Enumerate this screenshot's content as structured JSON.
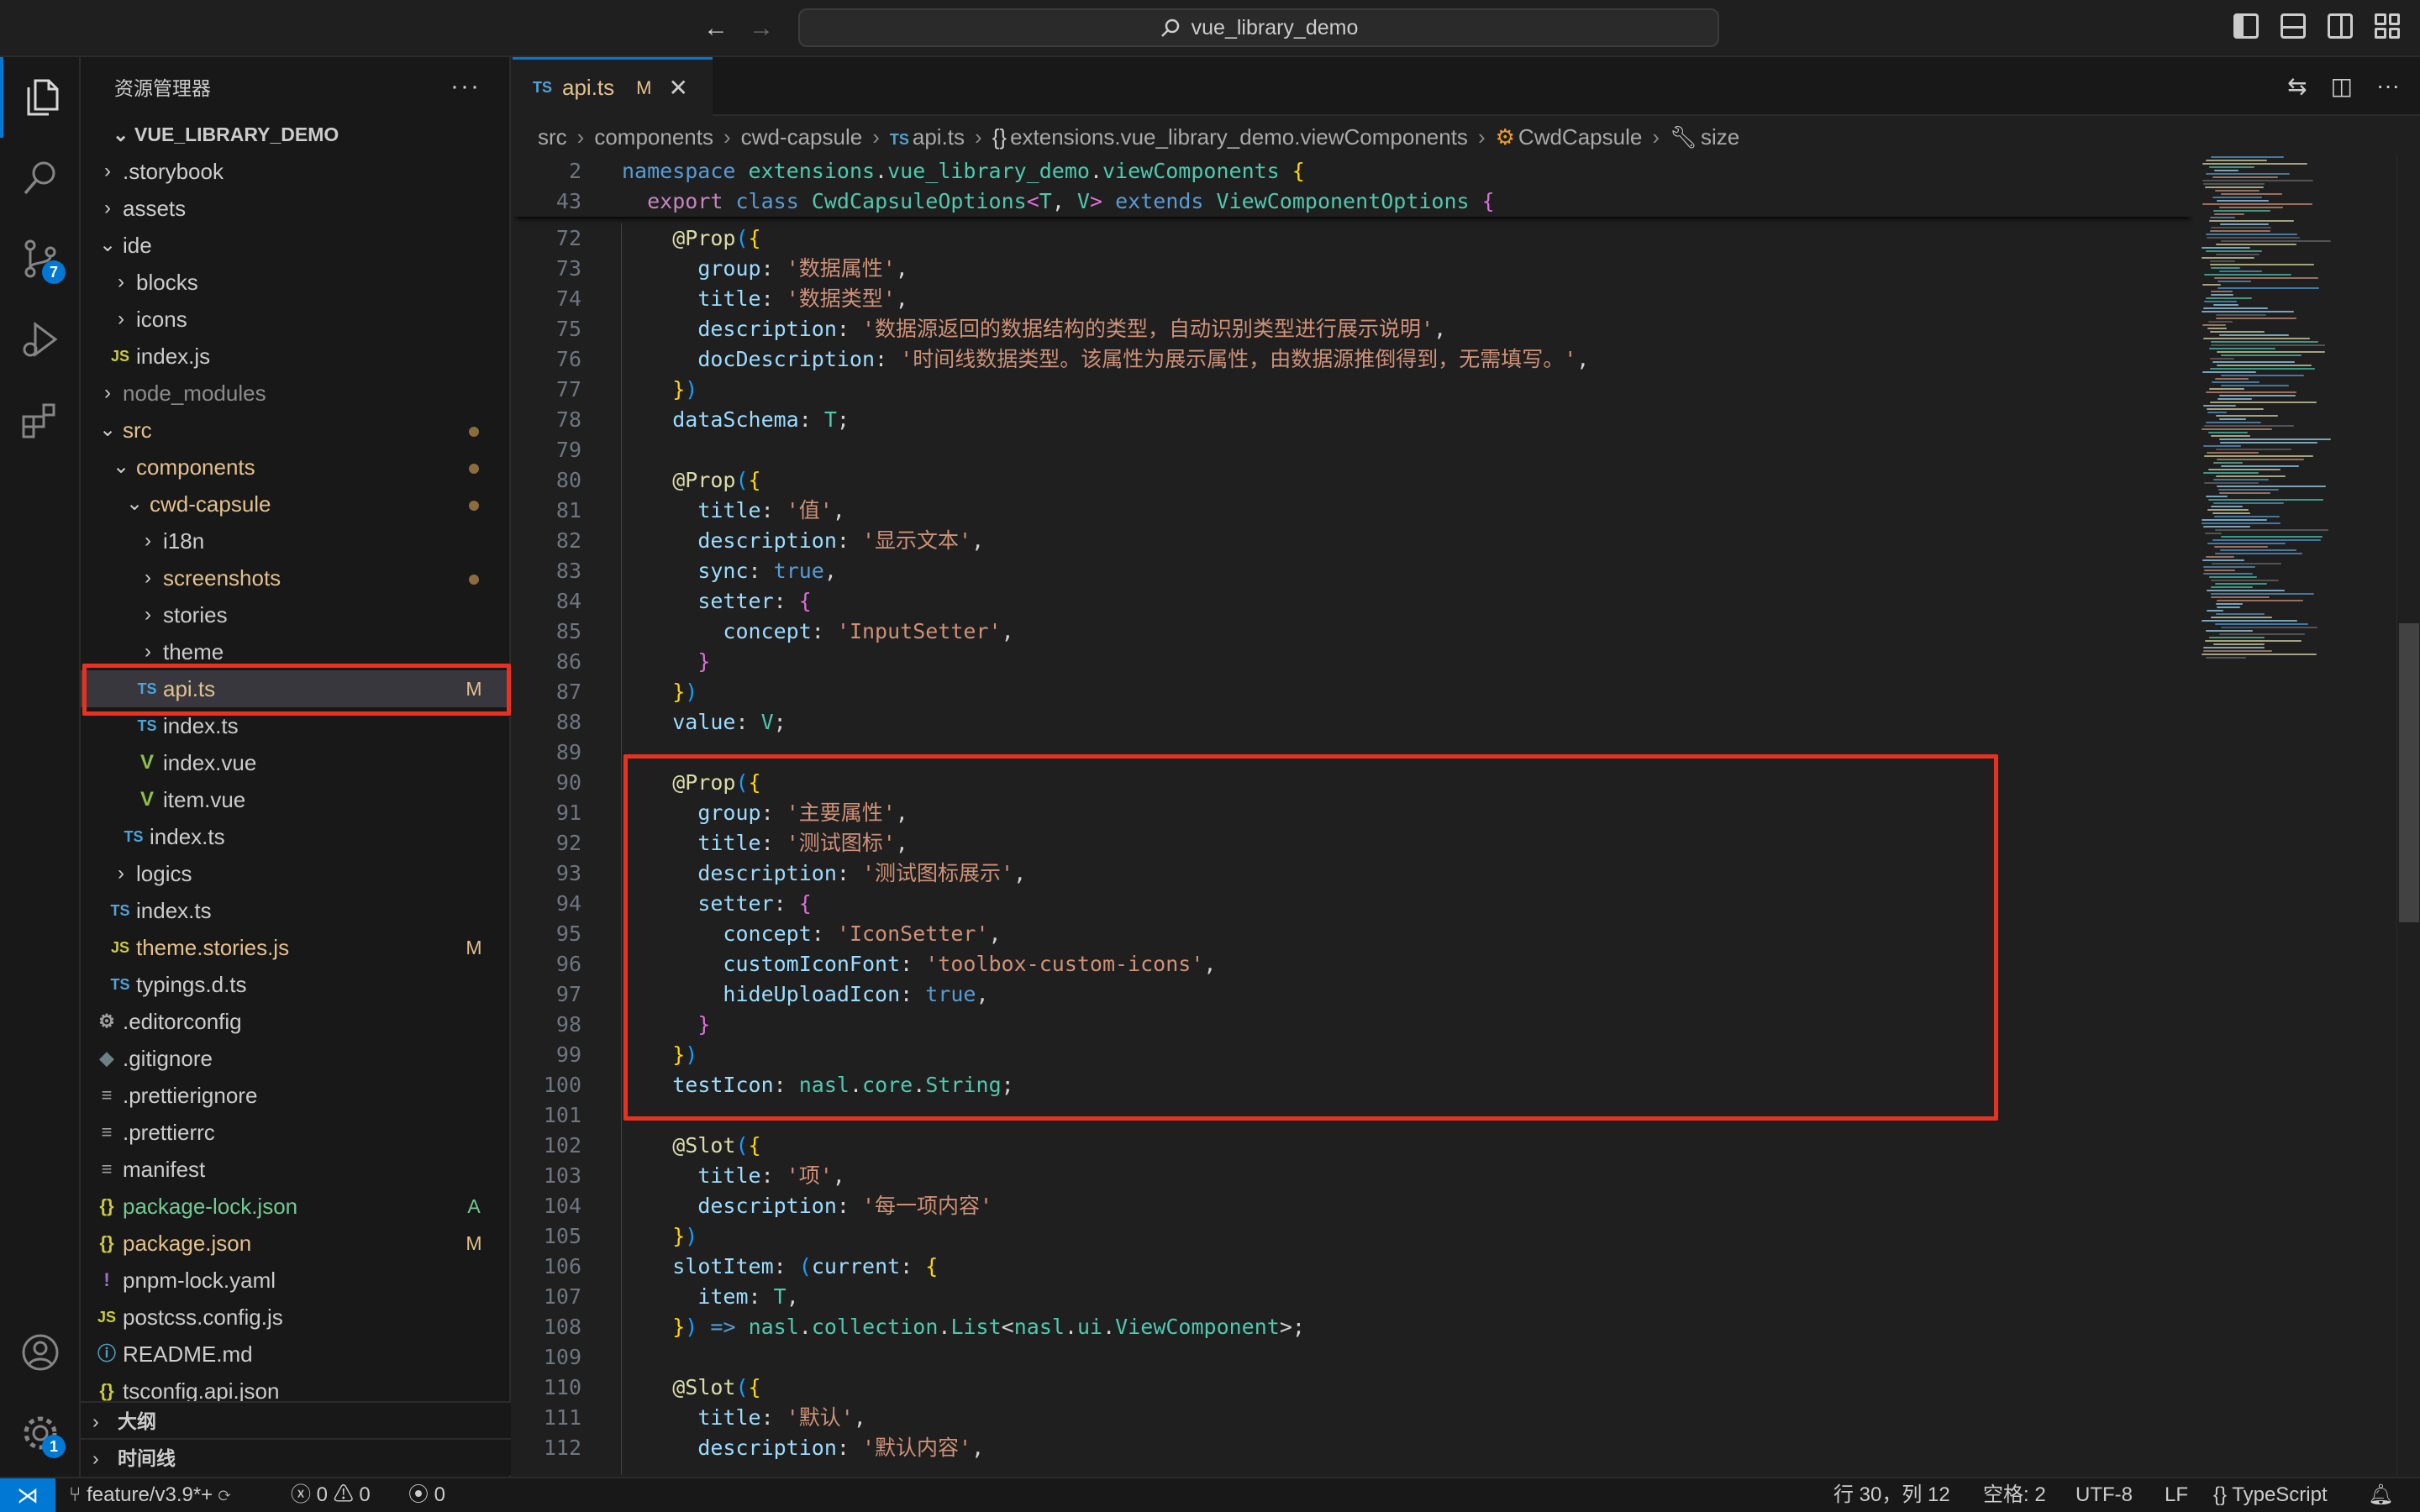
{
  "titlebar": {
    "back_icon": "arrow-left-icon",
    "forward_icon": "arrow-right-icon",
    "search_text": "vue_library_demo"
  },
  "activity": {
    "scm_badge": "7",
    "settings_badge": "1"
  },
  "sidebar": {
    "title": "资源管理器",
    "root": "VUE_LIBRARY_DEMO",
    "items": [
      {
        "label": ".storybook",
        "depth": 1,
        "kind": "folder",
        "open": false
      },
      {
        "label": "assets",
        "depth": 1,
        "kind": "folder",
        "open": false
      },
      {
        "label": "ide",
        "depth": 1,
        "kind": "folder",
        "open": true
      },
      {
        "label": "blocks",
        "depth": 2,
        "kind": "folder",
        "open": false
      },
      {
        "label": "icons",
        "depth": 2,
        "kind": "folder",
        "open": false
      },
      {
        "label": "index.js",
        "depth": 2,
        "kind": "js"
      },
      {
        "label": "node_modules",
        "depth": 1,
        "kind": "folder",
        "open": false,
        "dim": true
      },
      {
        "label": "src",
        "depth": 1,
        "kind": "folder",
        "open": true,
        "dot": true,
        "color": "#e2c08d"
      },
      {
        "label": "components",
        "depth": 2,
        "kind": "folder",
        "open": true,
        "dot": true,
        "color": "#e2c08d"
      },
      {
        "label": "cwd-capsule",
        "depth": 3,
        "kind": "folder",
        "open": true,
        "dot": true,
        "color": "#e2c08d"
      },
      {
        "label": "i18n",
        "depth": 4,
        "kind": "folder",
        "open": false
      },
      {
        "label": "screenshots",
        "depth": 4,
        "kind": "folder",
        "open": false,
        "dot": true,
        "color": "#e2c08d"
      },
      {
        "label": "stories",
        "depth": 4,
        "kind": "folder",
        "open": false
      },
      {
        "label": "theme",
        "depth": 4,
        "kind": "folder",
        "open": false
      },
      {
        "label": "api.ts",
        "depth": 4,
        "kind": "ts",
        "status": "M",
        "color": "#e2c08d",
        "selected": true
      },
      {
        "label": "index.ts",
        "depth": 4,
        "kind": "ts"
      },
      {
        "label": "index.vue",
        "depth": 4,
        "kind": "vue"
      },
      {
        "label": "item.vue",
        "depth": 4,
        "kind": "vue"
      },
      {
        "label": "index.ts",
        "depth": 3,
        "kind": "ts"
      },
      {
        "label": "logics",
        "depth": 2,
        "kind": "folder",
        "open": false
      },
      {
        "label": "index.ts",
        "depth": 2,
        "kind": "ts"
      },
      {
        "label": "theme.stories.js",
        "depth": 2,
        "kind": "js",
        "status": "M",
        "color": "#e2c08d"
      },
      {
        "label": "typings.d.ts",
        "depth": 2,
        "kind": "ts"
      },
      {
        "label": ".editorconfig",
        "depth": 1,
        "kind": "gear"
      },
      {
        "label": ".gitignore",
        "depth": 1,
        "kind": "git"
      },
      {
        "label": ".prettierignore",
        "depth": 1,
        "kind": "lines"
      },
      {
        "label": ".prettierrc",
        "depth": 1,
        "kind": "lines"
      },
      {
        "label": "manifest",
        "depth": 1,
        "kind": "lines"
      },
      {
        "label": "package-lock.json",
        "depth": 1,
        "kind": "json",
        "status": "A",
        "color": "#73c991"
      },
      {
        "label": "package.json",
        "depth": 1,
        "kind": "json",
        "status": "M",
        "color": "#e2c08d"
      },
      {
        "label": "pnpm-lock.yaml",
        "depth": 1,
        "kind": "yaml"
      },
      {
        "label": "postcss.config.js",
        "depth": 1,
        "kind": "js"
      },
      {
        "label": "README.md",
        "depth": 1,
        "kind": "info"
      },
      {
        "label": "tsconfig.api.json",
        "depth": 1,
        "kind": "json"
      }
    ],
    "outline_label": "大纲",
    "timeline_label": "时间线"
  },
  "editor": {
    "tab": {
      "type": "TS",
      "label": "api.ts",
      "status": "M"
    },
    "breadcrumb": {
      "parts": [
        "src",
        "components",
        "cwd-capsule"
      ],
      "file_type": "TS",
      "file": "api.ts",
      "namespace": "extensions.vue_library_demo.viewComponents",
      "class": "CwdCapsule",
      "member": "size"
    }
  },
  "code": {
    "sticky": [
      {
        "n": "2",
        "html": "<span class='kw'>namespace</span> <span class='ns'>extensions</span>.<span class='ns'>vue_library_demo</span>.<span class='ns'>viewComponents</span> <span class='b1'>{</span>"
      },
      {
        "n": "43",
        "html": "  <span class='kw2'>export</span> <span class='kw'>class</span> <span class='tp'>CwdCapsuleOptions</span><span class='b2'>&lt;</span><span class='tp'>T</span>, <span class='tp'>V</span><span class='b2'>&gt;</span> <span class='kw'>extends</span> <span class='tp'>ViewComponentOptions</span> <span class='b2'>{</span>"
      }
    ],
    "lines": [
      {
        "n": "72",
        "html": "    <span class='dec'>@Prop</span><span class='b3'>(</span><span class='b1'>{</span>"
      },
      {
        "n": "73",
        "html": "      <span class='prop'>group</span>: <span class='str'>'数据属性'</span>,"
      },
      {
        "n": "74",
        "html": "      <span class='prop'>title</span>: <span class='str'>'数据类型'</span>,"
      },
      {
        "n": "75",
        "html": "      <span class='prop'>description</span>: <span class='str'>'数据源返回的数据结构的类型，自动识别类型进行展示说明'</span>,"
      },
      {
        "n": "76",
        "html": "      <span class='prop'>docDescription</span>: <span class='str'>'时间线数据类型。该属性为展示属性，由数据源推倒得到，无需填写。'</span>,"
      },
      {
        "n": "77",
        "html": "    <span class='b1'>}</span><span class='b3'>)</span>"
      },
      {
        "n": "78",
        "html": "    <span class='prop'>dataSchema</span>: <span class='tp'>T</span>;"
      },
      {
        "n": "79",
        "html": ""
      },
      {
        "n": "80",
        "html": "    <span class='dec'>@Prop</span><span class='b3'>(</span><span class='b1'>{</span>"
      },
      {
        "n": "81",
        "html": "      <span class='prop'>title</span>: <span class='str'>'值'</span>,"
      },
      {
        "n": "82",
        "html": "      <span class='prop'>description</span>: <span class='str'>'显示文本'</span>,"
      },
      {
        "n": "83",
        "html": "      <span class='prop'>sync</span>: <span class='bool'>true</span>,"
      },
      {
        "n": "84",
        "html": "      <span class='prop'>setter</span>: <span class='b2'>{</span>"
      },
      {
        "n": "85",
        "html": "        <span class='prop'>concept</span>: <span class='str'>'InputSetter'</span>,"
      },
      {
        "n": "86",
        "html": "      <span class='b2'>}</span>"
      },
      {
        "n": "87",
        "html": "    <span class='b1'>}</span><span class='b3'>)</span>"
      },
      {
        "n": "88",
        "html": "    <span class='prop'>value</span>: <span class='tp'>V</span>;"
      },
      {
        "n": "89",
        "html": ""
      },
      {
        "n": "90",
        "html": "    <span class='dec'>@Prop</span><span class='b3'>(</span><span class='b1'>{</span>"
      },
      {
        "n": "91",
        "html": "      <span class='prop'>group</span>: <span class='str'>'主要属性'</span>,"
      },
      {
        "n": "92",
        "html": "      <span class='prop'>title</span>: <span class='str'>'测试图标'</span>,"
      },
      {
        "n": "93",
        "html": "      <span class='prop'>description</span>: <span class='str'>'测试图标展示'</span>,"
      },
      {
        "n": "94",
        "html": "      <span class='prop'>setter</span>: <span class='b2'>{</span>"
      },
      {
        "n": "95",
        "html": "        <span class='prop'>concept</span>: <span class='str'>'IconSetter'</span>,"
      },
      {
        "n": "96",
        "html": "        <span class='prop'>customIconFont</span>: <span class='str'>'toolbox-custom-icons'</span>,"
      },
      {
        "n": "97",
        "html": "        <span class='prop'>hideUploadIcon</span>: <span class='bool'>true</span>,"
      },
      {
        "n": "98",
        "html": "      <span class='b2'>}</span>"
      },
      {
        "n": "99",
        "html": "    <span class='b1'>}</span><span class='b3'>)</span>"
      },
      {
        "n": "100",
        "html": "    <span class='prop'>testIcon</span>: <span class='ns'>nasl</span>.<span class='ns'>core</span>.<span class='tp'>String</span>;"
      },
      {
        "n": "101",
        "html": ""
      },
      {
        "n": "102",
        "html": "    <span class='dec'>@Slot</span><span class='b3'>(</span><span class='b1'>{</span>"
      },
      {
        "n": "103",
        "html": "      <span class='prop'>title</span>: <span class='str'>'项'</span>,"
      },
      {
        "n": "104",
        "html": "      <span class='prop'>description</span>: <span class='str'>'每一项内容'</span>"
      },
      {
        "n": "105",
        "html": "    <span class='b1'>}</span><span class='b3'>)</span>"
      },
      {
        "n": "106",
        "html": "    <span class='prop'>slotItem</span>: <span class='b3'>(</span><span class='prop'>current</span>: <span class='b1'>{</span>"
      },
      {
        "n": "107",
        "html": "      <span class='prop'>item</span>: <span class='tp'>T</span>,"
      },
      {
        "n": "108",
        "html": "    <span class='b1'>}</span><span class='b3'>)</span> <span class='kw'>=&gt;</span> <span class='ns'>nasl</span>.<span class='ns'>collection</span>.<span class='tp'>List</span>&lt;<span class='ns'>nasl</span>.<span class='ns'>ui</span>.<span class='tp'>ViewComponent</span>&gt;;"
      },
      {
        "n": "109",
        "html": ""
      },
      {
        "n": "110",
        "html": "    <span class='dec'>@Slot</span><span class='b3'>(</span><span class='b1'>{</span>"
      },
      {
        "n": "111",
        "html": "      <span class='prop'>title</span>: <span class='str'>'默认'</span>,"
      },
      {
        "n": "112",
        "html": "      <span class='prop'>description</span>: <span class='str'>'默认内容'</span>,"
      }
    ]
  },
  "statusbar": {
    "branch": "feature/v3.9*+",
    "errors": "0",
    "warnings": "0",
    "ports": "0",
    "cursor": "行 30，列 12",
    "indent": "空格: 2",
    "encoding": "UTF-8",
    "eol": "LF",
    "language": "TypeScript"
  }
}
